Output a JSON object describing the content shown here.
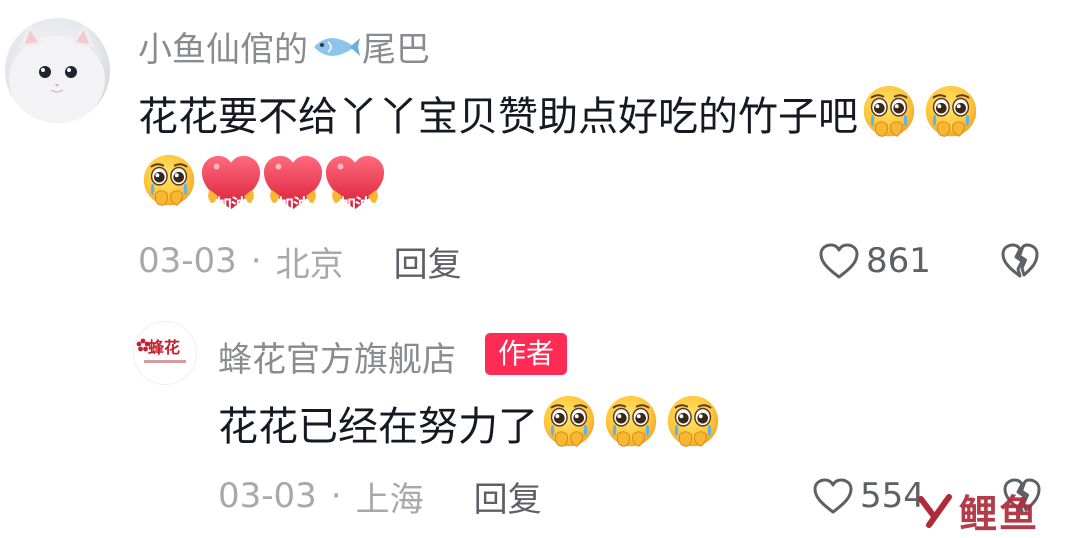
{
  "comment": {
    "user_name_prefix": "小鱼仙倌的",
    "user_name_suffix": "尾巴",
    "text": "花花要不给丫丫宝贝赞助点好吃的竹子吧",
    "sticker_text": "加油",
    "date": "03-03",
    "separator": "·",
    "location": "北京",
    "reply_label": "回复",
    "like_count": "861"
  },
  "reply": {
    "user_name": "蜂花官方旗舰店",
    "brand_logo_text": "蜂花",
    "author_badge": "作者",
    "text": "花花已经在努力了",
    "date": "03-03",
    "separator": "·",
    "location": "上海",
    "reply_label": "回复",
    "like_count": "554"
  },
  "watermark": {
    "text": "鲤鱼"
  },
  "icons": {
    "emoji": "pleading-face-icon",
    "sticker": "heart-jiayou-sticker",
    "like": "heart-outline-icon",
    "dislike": "broken-heart-icon",
    "user_name_emoji": "fish-icon"
  },
  "colors": {
    "author_badge": "#fe2c55",
    "primary_text": "#161823",
    "secondary_text": "#8a8b91",
    "meta_text": "#a7a8ad",
    "sticker_heart": "#e8334a",
    "emoji_face": "#ffc83d"
  }
}
